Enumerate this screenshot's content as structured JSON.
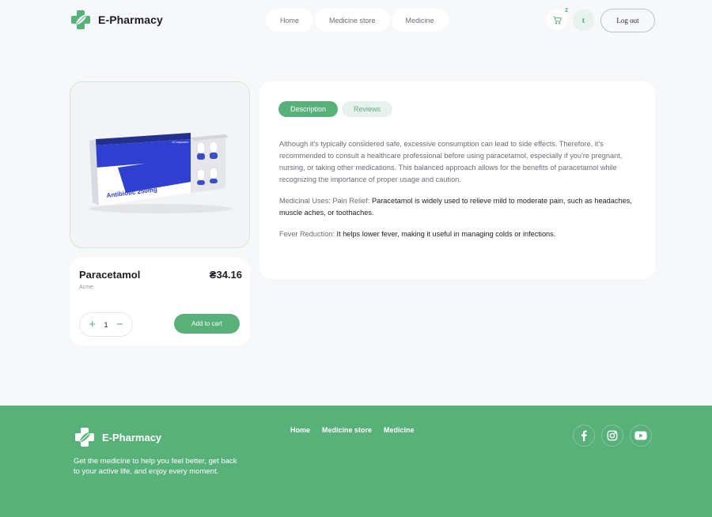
{
  "header": {
    "logo_text": "E-Pharmacy",
    "nav": [
      {
        "label": "Home"
      },
      {
        "label": "Medicine store"
      },
      {
        "label": "Medicine"
      }
    ],
    "cart_count": "2",
    "avatar_initial": "t",
    "logout_label": "Log out"
  },
  "product": {
    "name": "Paracetamol",
    "price": "₴34.16",
    "brand": "Acme",
    "quantity": "1",
    "add_to_cart_label": "Add to cart",
    "image_box_top": "10 capsules",
    "image_box_label": "Antibiotic 250mg"
  },
  "details": {
    "tabs": [
      {
        "label": "Description"
      },
      {
        "label": "Reviews"
      }
    ],
    "paragraph1": "Although it's typically considered safe, excessive consumption can lead to side effects. Therefore, it's recommended to consult a healthcare professional before using paracetamol, especially if you're pregnant, nursing, or taking other medications. This balanced approach allows for the benefits of paracetamol while recognizing the importance of proper usage and caution.",
    "uses_label": "Medicinal Uses: Pain Relief:",
    "uses_text": "Paracetamol is widely used to relieve mild to moderate pain, such as headaches, muscle aches, or toothaches.",
    "fever_label": "Fever Reduction:",
    "fever_text": "It helps lower fever, making it useful in managing colds or infections."
  },
  "footer": {
    "logo_text": "E-Pharmacy",
    "tagline": "Get the medicine to help you feel better, get back to your active life, and enjoy every moment.",
    "nav": [
      {
        "label": "Home"
      },
      {
        "label": "Medicine store"
      },
      {
        "label": "Medicine"
      }
    ],
    "socials": [
      "facebook-icon",
      "instagram-icon",
      "youtube-icon"
    ]
  },
  "colors": {
    "accent": "#59b17a",
    "accent_light": "#e7f1ed",
    "background": "#f7f8fa"
  }
}
